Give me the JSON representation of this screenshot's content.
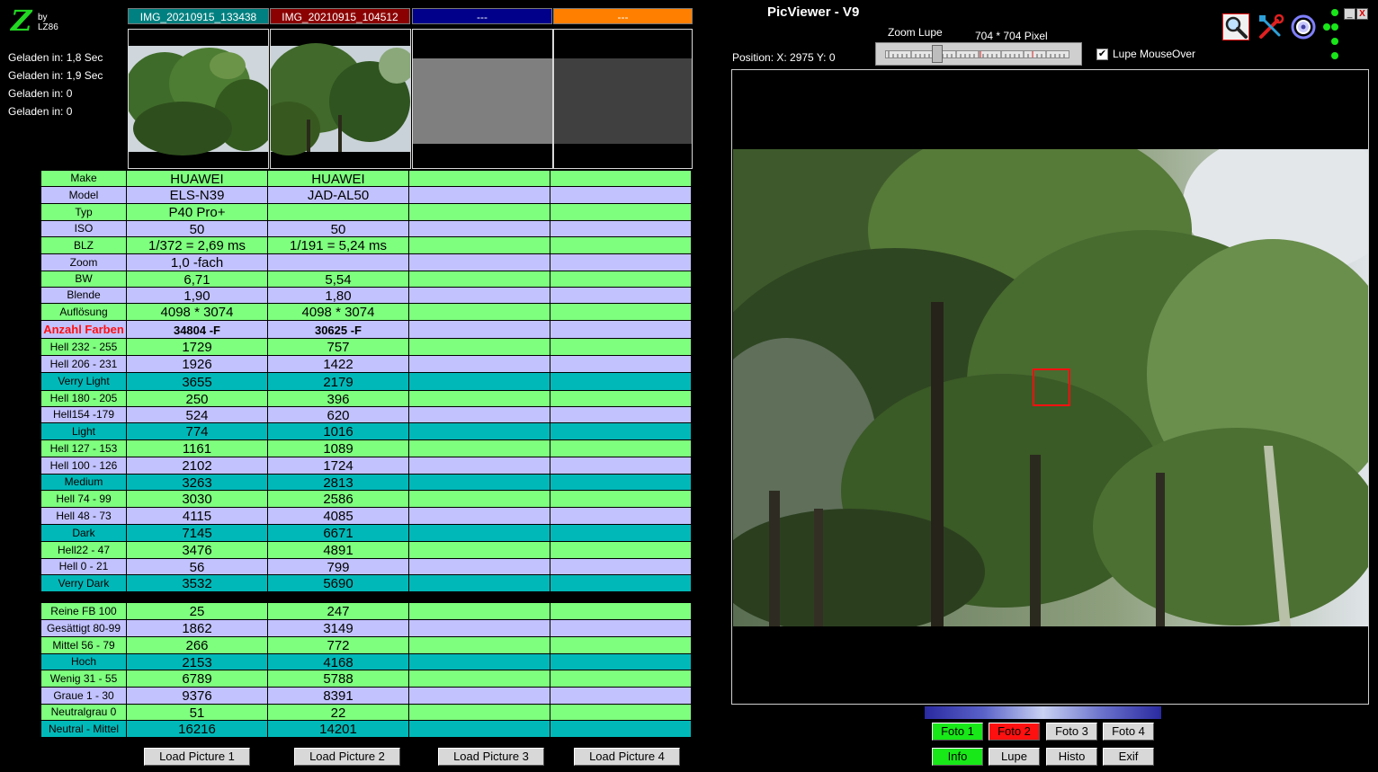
{
  "app": {
    "title": "PicViewer - V9",
    "logo_letter": "Z",
    "logo_by": "by LZ86"
  },
  "load_info": [
    "Geladen in: 1,8 Sec",
    "Geladen in: 1,9 Sec",
    "Geladen in: 0",
    "Geladen in: 0"
  ],
  "images": [
    {
      "name": "IMG_20210915_133438",
      "color": "#008080"
    },
    {
      "name": "IMG_20210915_104512",
      "color": "#8b0000"
    },
    {
      "name": "---",
      "color": "#00008b"
    },
    {
      "name": "---",
      "color": "#ff8000"
    }
  ],
  "table": {
    "rows": [
      {
        "label": "Make",
        "style": "g",
        "values": [
          "HUAWEI",
          "HUAWEI",
          "",
          ""
        ]
      },
      {
        "label": "Model",
        "style": "p",
        "values": [
          "ELS-N39",
          "JAD-AL50",
          "",
          ""
        ]
      },
      {
        "label": "Typ",
        "style": "g",
        "values": [
          "P40 Pro+",
          "",
          "",
          ""
        ]
      },
      {
        "label": "ISO",
        "style": "p",
        "values": [
          "50",
          "50",
          "",
          ""
        ]
      },
      {
        "label": "BLZ",
        "style": "g",
        "values": [
          "1/372 = 2,69 ms",
          "1/191 = 5,24 ms",
          "",
          ""
        ]
      },
      {
        "label": "Zoom",
        "style": "p",
        "values": [
          "1,0 -fach",
          "",
          "",
          ""
        ]
      },
      {
        "label": "BW",
        "style": "g",
        "values": [
          "6,71",
          "5,54",
          "",
          ""
        ]
      },
      {
        "label": "Blende",
        "style": "p",
        "values": [
          "1,90",
          "1,80",
          "",
          ""
        ]
      },
      {
        "label": "Auflösung",
        "style": "g",
        "values": [
          "4098 * 3074",
          "4098 * 3074",
          "",
          ""
        ]
      },
      {
        "label": "Anzahl Farben",
        "style": "p",
        "values": [
          "34804 -F",
          "30625 -F",
          "",
          ""
        ]
      },
      {
        "label": "Hell 232 - 255",
        "style": "g",
        "values": [
          "1729",
          "757",
          "",
          ""
        ]
      },
      {
        "label": "Hell 206 - 231",
        "style": "p",
        "values": [
          "1926",
          "1422",
          "",
          ""
        ]
      },
      {
        "label": "Verry Light",
        "style": "t",
        "values": [
          "3655",
          "2179",
          "",
          ""
        ]
      },
      {
        "label": "Hell 180 - 205",
        "style": "g",
        "values": [
          "250",
          "396",
          "",
          ""
        ]
      },
      {
        "label": "Hell154 -179",
        "style": "p",
        "values": [
          "524",
          "620",
          "",
          ""
        ]
      },
      {
        "label": "Light",
        "style": "t",
        "values": [
          "774",
          "1016",
          "",
          ""
        ]
      },
      {
        "label": "Hell 127 - 153",
        "style": "g",
        "values": [
          "1161",
          "1089",
          "",
          ""
        ]
      },
      {
        "label": "Hell 100 - 126",
        "style": "p",
        "values": [
          "2102",
          "1724",
          "",
          ""
        ]
      },
      {
        "label": "Medium",
        "style": "t",
        "values": [
          "3263",
          "2813",
          "",
          ""
        ]
      },
      {
        "label": "Hell 74 - 99",
        "style": "g",
        "values": [
          "3030",
          "2586",
          "",
          ""
        ]
      },
      {
        "label": "Hell 48 - 73",
        "style": "p",
        "values": [
          "4115",
          "4085",
          "",
          ""
        ]
      },
      {
        "label": "Dark",
        "style": "t",
        "values": [
          "7145",
          "6671",
          "",
          ""
        ]
      },
      {
        "label": "Hell22 - 47",
        "style": "g",
        "values": [
          "3476",
          "4891",
          "",
          ""
        ]
      },
      {
        "label": "Hell 0 - 21",
        "style": "p",
        "values": [
          "56",
          "799",
          "",
          ""
        ]
      },
      {
        "label": "Verry Dark",
        "style": "t",
        "values": [
          "3532",
          "5690",
          "",
          ""
        ]
      },
      {
        "label": "Reine FB 100",
        "style": "g",
        "values": [
          "25",
          "247",
          "",
          ""
        ]
      },
      {
        "label": "Gesättigt 80-99",
        "style": "p",
        "values": [
          "1862",
          "3149",
          "",
          ""
        ]
      },
      {
        "label": "Mittel 56 - 79",
        "style": "g",
        "values": [
          "266",
          "772",
          "",
          ""
        ]
      },
      {
        "label": "Hoch",
        "style": "t",
        "values": [
          "2153",
          "4168",
          "",
          ""
        ]
      },
      {
        "label": "Wenig 31 - 55",
        "style": "g",
        "values": [
          "6789",
          "5788",
          "",
          ""
        ]
      },
      {
        "label": "Graue 1 - 30",
        "style": "p",
        "values": [
          "9376",
          "8391",
          "",
          ""
        ]
      },
      {
        "label": "Neutralgrau 0",
        "style": "g",
        "values": [
          "51",
          "22",
          "",
          ""
        ]
      },
      {
        "label": "Neutral - Mittel",
        "style": "t",
        "values": [
          "16216",
          "14201",
          "",
          ""
        ]
      }
    ]
  },
  "load_buttons": [
    "Load Picture 1",
    "Load Picture 2",
    "Load Picture 3",
    "Load Picture 4"
  ],
  "viewer": {
    "position_text": "Position: X: 2975 Y: 0",
    "zoom_label": "Zoom Lupe",
    "pixel_label": "704 * 704 Pixel",
    "checkbox_label": "Lupe MouseOver",
    "checkbox_checked": true
  },
  "foto_buttons": [
    {
      "label": "Foto 1",
      "color": "#18e818"
    },
    {
      "label": "Foto 2",
      "color": "#ff1010"
    },
    {
      "label": "Foto 3",
      "color": "#d8d8d8"
    },
    {
      "label": "Foto 4",
      "color": "#d8d8d8"
    }
  ],
  "mode_buttons": [
    {
      "label": "Info",
      "color": "#18e818"
    },
    {
      "label": "Lupe",
      "color": "#d8d8d8"
    },
    {
      "label": "Histo",
      "color": "#d8d8d8"
    },
    {
      "label": "Exif",
      "color": "#d8d8d8"
    }
  ],
  "icons": [
    "magnifier-icon",
    "tools-icon",
    "settings-wheel-icon"
  ],
  "window_buttons": [
    "_",
    "X"
  ]
}
